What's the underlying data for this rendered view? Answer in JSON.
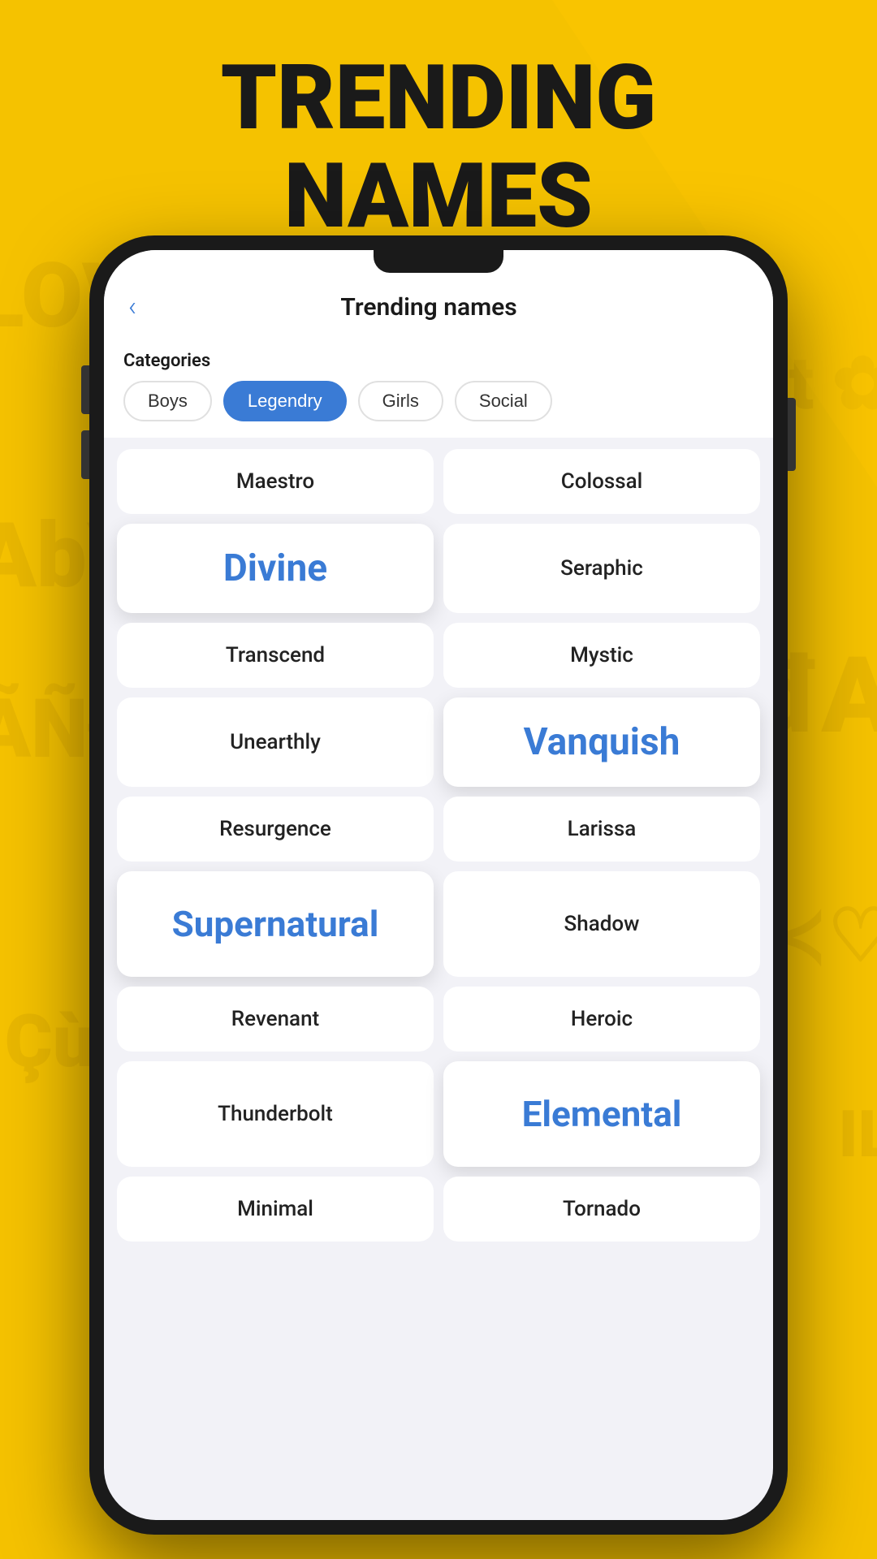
{
  "page": {
    "background_text": [
      "LOVE",
      "AbY C",
      "årt ✿",
      "ÃÑÐŞ",
      "đA",
      "AR♥≺♡",
      "°Çù",
      "IL"
    ],
    "heading_line1": "TRENDING",
    "heading_line2": "NAMES"
  },
  "header": {
    "title": "Trending names",
    "back_label": "‹"
  },
  "categories": {
    "label": "Categories",
    "items": [
      {
        "id": "boys",
        "label": "Boys",
        "active": false
      },
      {
        "id": "legendry",
        "label": "Legendry",
        "active": true
      },
      {
        "id": "girls",
        "label": "Girls",
        "active": false
      },
      {
        "id": "social",
        "label": "Social",
        "active": false
      }
    ]
  },
  "names": [
    {
      "id": "maestro",
      "label": "Maestro",
      "featured": false
    },
    {
      "id": "colossal",
      "label": "Colossal",
      "featured": false
    },
    {
      "id": "divine",
      "label": "Divine",
      "featured": true,
      "size": "large"
    },
    {
      "id": "seraphic",
      "label": "Seraphic",
      "featured": false
    },
    {
      "id": "transcend",
      "label": "Transcend",
      "featured": false
    },
    {
      "id": "mystic",
      "label": "Mystic",
      "featured": false
    },
    {
      "id": "unearthly",
      "label": "Unearthly",
      "featured": false
    },
    {
      "id": "vanquish",
      "label": "Vanquish",
      "featured": true,
      "size": "large"
    },
    {
      "id": "resurgence",
      "label": "Resurgence",
      "featured": false
    },
    {
      "id": "larissa",
      "label": "Larissa",
      "featured": false
    },
    {
      "id": "supernatural",
      "label": "Supernatural",
      "featured": true,
      "size": "xl"
    },
    {
      "id": "shadow",
      "label": "Shadow",
      "featured": false
    },
    {
      "id": "revenant",
      "label": "Revenant",
      "featured": false
    },
    {
      "id": "heroic",
      "label": "Heroic",
      "featured": false
    },
    {
      "id": "thunderbolt",
      "label": "Thunderbolt",
      "featured": false
    },
    {
      "id": "elemental",
      "label": "Elemental",
      "featured": true,
      "size": "xl"
    },
    {
      "id": "minimal",
      "label": "Minimal",
      "featured": false
    },
    {
      "id": "tornado",
      "label": "Tornado",
      "featured": false
    }
  ]
}
